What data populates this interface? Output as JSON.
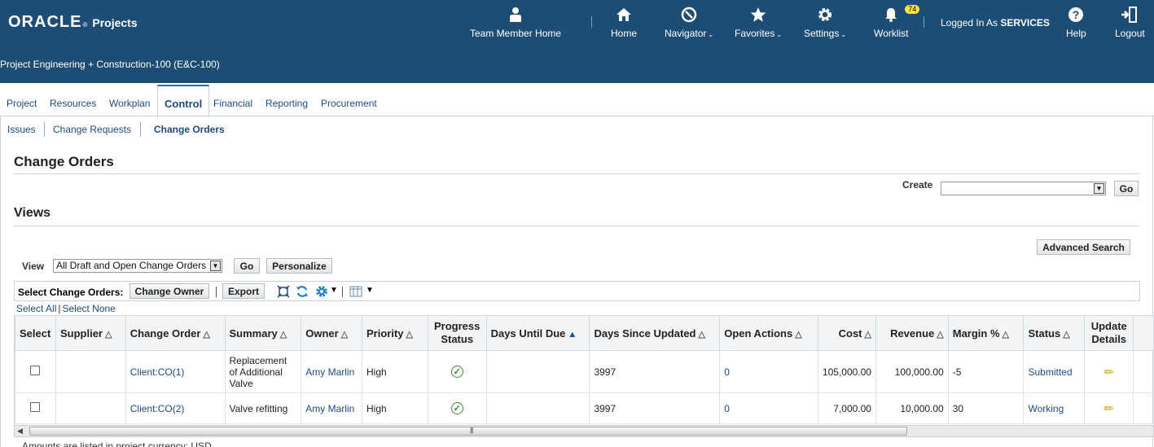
{
  "brand": {
    "logo": "ORACLE",
    "tm": "®",
    "app": "Projects"
  },
  "project_name": "Project Engineering + Construction-100 (E&C-100)",
  "global_nav": {
    "team_member_home": "Team Member Home",
    "home": "Home",
    "navigator": "Navigator",
    "favorites": "Favorites",
    "settings": "Settings",
    "worklist": "Worklist",
    "worklist_count": "74",
    "logged_in_prefix": "Logged In As",
    "logged_in_user": "SERVICES",
    "help": "Help",
    "logout": "Logout"
  },
  "tabs": [
    "Project",
    "Resources",
    "Workplan",
    "Control",
    "Financial",
    "Reporting",
    "Procurement"
  ],
  "active_tab": "Control",
  "subtabs": [
    "Issues",
    "Change Requests",
    "Change Orders"
  ],
  "active_subtab": "Change Orders",
  "page_title": "Change Orders",
  "create": {
    "label": "Create",
    "value": "",
    "go": "Go"
  },
  "views": {
    "heading": "Views",
    "advanced_search": "Advanced Search",
    "view_label": "View",
    "view_value": "All Draft and Open Change Orders",
    "go": "Go",
    "personalize": "Personalize"
  },
  "toolbar": {
    "label": "Select Change Orders:",
    "change_owner": "Change Owner",
    "export": "Export",
    "select_all": "Select All",
    "select_none": "Select None"
  },
  "table": {
    "headers": {
      "select": "Select",
      "supplier": "Supplier",
      "change_order": "Change Order",
      "summary": "Summary",
      "owner": "Owner",
      "priority": "Priority",
      "progress_status": "Progress Status",
      "days_until_due": "Days Until Due",
      "days_since_updated": "Days Since Updated",
      "open_actions": "Open Actions",
      "cost": "Cost",
      "revenue": "Revenue",
      "margin": "Margin %",
      "status": "Status",
      "update_details": "Update Details"
    },
    "rows": [
      {
        "supplier": "",
        "change_order": "Client:CO(1)",
        "summary": "Replacement of Additional Valve",
        "owner": "Amy Marlin",
        "priority": "High",
        "days_until_due": "",
        "days_since_updated": "3997",
        "open_actions": "0",
        "cost": "105,000.00",
        "revenue": "100,000.00",
        "margin": "-5",
        "status": "Submitted"
      },
      {
        "supplier": "",
        "change_order": "Client:CO(2)",
        "summary": "Valve refitting",
        "owner": "Amy Marlin",
        "priority": "High",
        "days_until_due": "",
        "days_since_updated": "3997",
        "open_actions": "0",
        "cost": "7,000.00",
        "revenue": "10,000.00",
        "margin": "30",
        "status": "Working"
      }
    ]
  },
  "footnote": "Amounts are listed in project currency: USD"
}
